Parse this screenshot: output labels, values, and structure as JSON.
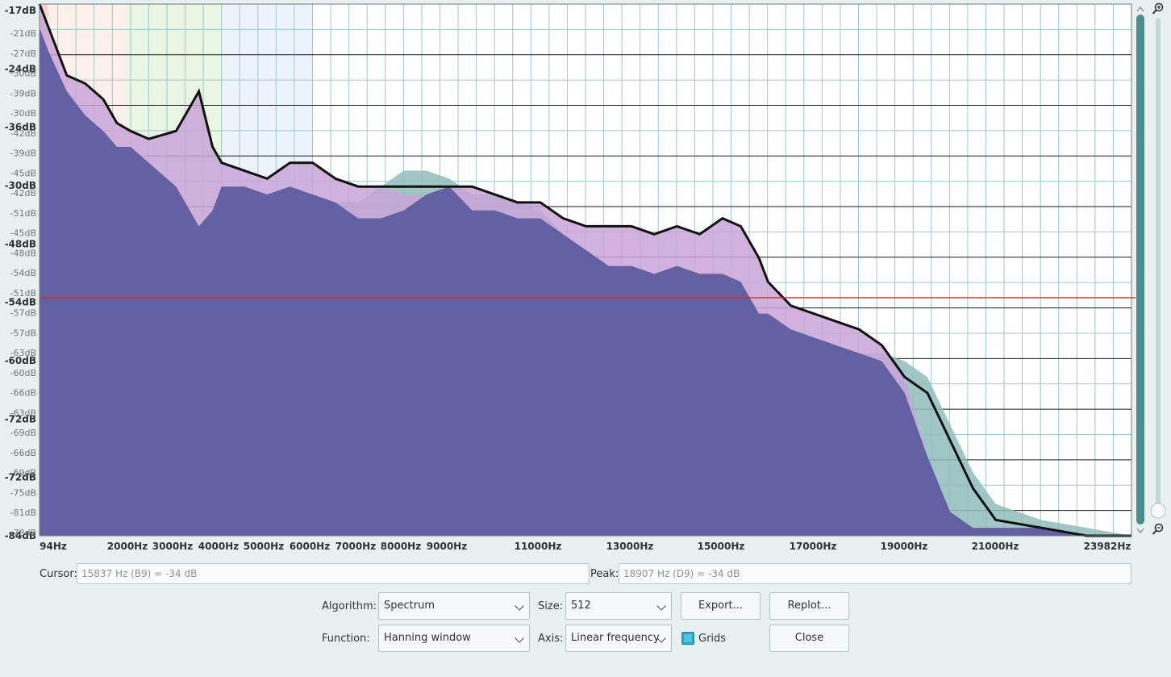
{
  "chart_data": {
    "type": "area",
    "title": "",
    "xlabel": "",
    "ylabel": "",
    "x_ticks": [
      "94Hz",
      "2000Hz",
      "3000Hz",
      "4000Hz",
      "5000Hz",
      "6000Hz",
      "7000Hz",
      "8000Hz",
      "9000Hz",
      "11000Hz",
      "13000Hz",
      "15000Hz",
      "17000Hz",
      "19000Hz",
      "21000Hz",
      "23982Hz"
    ],
    "y_ticks_bold": [
      "-17dB",
      "-24dB",
      "-36dB",
      "-30dB",
      "-48dB",
      "-54dB",
      "-60dB",
      "-72dB",
      "-72dB",
      "-84dB"
    ],
    "y_ticks_light": [
      "-21dB",
      "-27dB",
      "-30dB",
      "-39dB",
      "-30dB",
      "-42dB",
      "-39dB",
      "-45dB",
      "-42dB",
      "-51dB",
      "-45dB",
      "-48dB",
      "-54dB",
      "-51dB",
      "-57dB",
      "-57dB",
      "-63dB",
      "-60dB",
      "-66dB",
      "-63dB",
      "-69dB",
      "-66dB",
      "-69dB",
      "-75dB",
      "-81dB",
      "-78dB"
    ],
    "xlim": [
      0,
      23982
    ],
    "ylim": [
      -84,
      -17
    ],
    "grid": true,
    "cursor_level_db": -54,
    "series": [
      {
        "color": "#5b5b9e",
        "x": [
          0,
          200,
          600,
          1000,
          1400,
          1700,
          2000,
          2400,
          3000,
          3300,
          3500,
          3800,
          4000,
          4500,
          5000,
          5500,
          6000,
          6500,
          7000,
          7500,
          8000,
          8500,
          9000,
          9500,
          10000,
          10500,
          11000,
          11500,
          12000,
          12500,
          13000,
          13500,
          14000,
          14500,
          15000,
          15400,
          15800,
          16000,
          16500,
          17000,
          17500,
          18000,
          18500,
          19000,
          19500,
          20000,
          20500,
          21000,
          22000,
          23000,
          23982
        ],
        "y": [
          -20,
          -23,
          -28,
          -31,
          -33,
          -35,
          -35,
          -37,
          -40,
          -43,
          -45,
          -43,
          -40,
          -40,
          -41,
          -40,
          -41,
          -42,
          -44,
          -44,
          -43,
          -41,
          -40,
          -43,
          -43,
          -44,
          -44,
          -46,
          -48,
          -50,
          -50,
          -51,
          -50,
          -51,
          -51,
          -52,
          -56,
          -56,
          -58,
          -59,
          -60,
          -61,
          -62,
          -66,
          -74,
          -81,
          -83,
          -83,
          -83,
          -84,
          -84
        ]
      },
      {
        "color": "#c9a4d8",
        "x": [
          0,
          200,
          600,
          1000,
          1400,
          1700,
          2000,
          2400,
          3000,
          3300,
          3500,
          3800,
          4000,
          4500,
          5000,
          5500,
          6000,
          6500,
          7000,
          7500,
          8000,
          8500,
          9000,
          9500,
          10000,
          10500,
          11000,
          11500,
          12000,
          12500,
          13000,
          13500,
          14000,
          14500,
          15000,
          15400,
          15800,
          16000,
          16500,
          17000,
          17500,
          18000,
          18500,
          19000,
          19500,
          20000,
          20500,
          21000,
          22000,
          23000,
          23982
        ],
        "y": [
          -17,
          -20,
          -26,
          -27,
          -29,
          -32,
          -33,
          -34,
          -33,
          -30,
          -28,
          -35,
          -37,
          -38,
          -39,
          -37,
          -37,
          -39,
          -40,
          -40,
          -41,
          -41,
          -40,
          -40,
          -41,
          -42,
          -42,
          -44,
          -45,
          -45,
          -45,
          -46,
          -45,
          -46,
          -44,
          -45,
          -49,
          -52,
          -55,
          -56,
          -57,
          -58,
          -60,
          -64,
          -74,
          -81,
          -83,
          -83,
          -83,
          -84,
          -84
        ]
      },
      {
        "color": "#8fbcbc",
        "x": [
          0,
          200,
          600,
          1000,
          1400,
          1700,
          2000,
          2400,
          3000,
          3300,
          3500,
          3800,
          4000,
          4500,
          5000,
          5500,
          6000,
          6500,
          7000,
          7500,
          8000,
          8500,
          9000,
          9500,
          10000,
          10500,
          11000,
          11500,
          12000,
          12500,
          13000,
          13500,
          14000,
          14500,
          15000,
          15400,
          15800,
          16000,
          16500,
          17000,
          17500,
          18000,
          18500,
          19000,
          19500,
          20000,
          20500,
          21000,
          22000,
          23000,
          23982
        ],
        "y": [
          -20,
          -23,
          -28,
          -31,
          -33,
          -35,
          -35,
          -37,
          -40,
          -43,
          -45,
          -43,
          -40,
          -40,
          -41,
          -40,
          -41,
          -42,
          -42,
          -40,
          -38,
          -38,
          -39,
          -41,
          -41,
          -42,
          -43,
          -46,
          -48,
          -50,
          -50,
          -51,
          -50,
          -51,
          -51,
          -52,
          -56,
          -56,
          -58,
          -59,
          -60,
          -61,
          -61,
          -62,
          -64,
          -70,
          -76,
          -80,
          -82,
          -83,
          -84
        ]
      }
    ]
  },
  "cursor": {
    "label": "Cursor:",
    "value": "15837 Hz (B9) = -34 dB"
  },
  "peak": {
    "label": "Peak:",
    "value": "18907 Hz (D9) = -34 dB"
  },
  "algorithm": {
    "label": "Algorithm:",
    "value": "Spectrum"
  },
  "size": {
    "label": "Size:",
    "value": "512"
  },
  "function": {
    "label": "Function:",
    "value": "Hanning window"
  },
  "axis": {
    "label": "Axis:",
    "value": "Linear frequency"
  },
  "buttons": {
    "export": "Export...",
    "replot": "Replot...",
    "close": "Close"
  },
  "grids": {
    "label": "Grids",
    "checked": true
  },
  "colors": {
    "accent": "#2ba3c7",
    "cursor_line": "#c0392b"
  }
}
